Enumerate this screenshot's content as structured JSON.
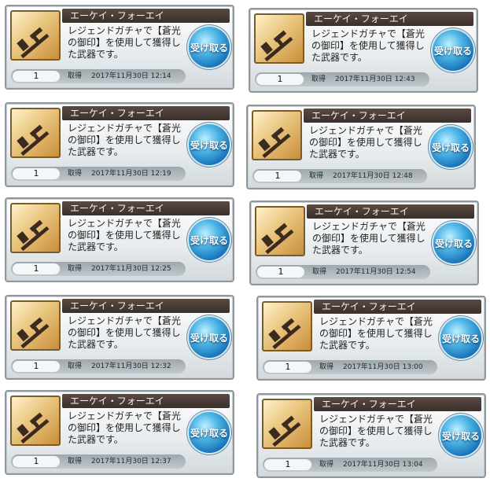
{
  "cards": [
    {
      "item_name": "エーケイ・フォーエイ",
      "desc_l1": "レジェンドガチャで【蒼光",
      "desc_l2": "の御印】を使用して獲得し",
      "desc_l3": "た武器です。",
      "receive_label": "受け取る",
      "quantity": "1",
      "acquired_label": "取得",
      "acquired_at": "2017年11月30日 12:14",
      "icon": "assault-rifle-icon"
    },
    {
      "item_name": "エーケイ・フォーエイ",
      "desc_l1": "レジェンドガチャで【蒼光",
      "desc_l2": "の御印】を使用して獲得し",
      "desc_l3": "た武器です。",
      "receive_label": "受け取る",
      "quantity": "1",
      "acquired_label": "取得",
      "acquired_at": "2017年11月30日 12:43",
      "icon": "assault-rifle-icon"
    },
    {
      "item_name": "エーケイ・フォーエイ",
      "desc_l1": "レジェンドガチャで【蒼光",
      "desc_l2": "の御印】を使用して獲得し",
      "desc_l3": "た武器です。",
      "receive_label": "受け取る",
      "quantity": "1",
      "acquired_label": "取得",
      "acquired_at": "2017年11月30日 12:19",
      "icon": "assault-rifle-icon"
    },
    {
      "item_name": "エーケイ・フォーエイ",
      "desc_l1": "レジェンドガチャで【蒼光",
      "desc_l2": "の御印】を使用して獲得し",
      "desc_l3": "た武器です。",
      "receive_label": "受け取る",
      "quantity": "1",
      "acquired_label": "取得",
      "acquired_at": "2017年11月30日 12:48",
      "icon": "assault-rifle-icon"
    },
    {
      "item_name": "エーケイ・フォーエイ",
      "desc_l1": "レジェンドガチャで【蒼光",
      "desc_l2": "の御印】を使用して獲得し",
      "desc_l3": "た武器です。",
      "receive_label": "受け取る",
      "quantity": "1",
      "acquired_label": "取得",
      "acquired_at": "2017年11月30日 12:25",
      "icon": "assault-rifle-icon"
    },
    {
      "item_name": "エーケイ・フォーエイ",
      "desc_l1": "レジェンドガチャで【蒼光",
      "desc_l2": "の御印】を使用して獲得し",
      "desc_l3": "た武器です。",
      "receive_label": "受け取る",
      "quantity": "1",
      "acquired_label": "取得",
      "acquired_at": "2017年11月30日 12:54",
      "icon": "assault-rifle-icon"
    },
    {
      "item_name": "エーケイ・フォーエイ",
      "desc_l1": "レジェンドガチャで【蒼光",
      "desc_l2": "の御印】を使用して獲得し",
      "desc_l3": "た武器です。",
      "receive_label": "受け取る",
      "quantity": "1",
      "acquired_label": "取得",
      "acquired_at": "2017年11月30日 12:32",
      "icon": "assault-rifle-icon"
    },
    {
      "item_name": "エーケイ・フォーエイ",
      "desc_l1": "レジェンドガチャで【蒼光",
      "desc_l2": "の御印】を使用して獲得し",
      "desc_l3": "た武器です。",
      "receive_label": "受け取る",
      "quantity": "1",
      "acquired_label": "取得",
      "acquired_at": "2017年11月30日 13:00",
      "icon": "assault-rifle-icon"
    },
    {
      "item_name": "エーケイ・フォーエイ",
      "desc_l1": "レジェンドガチャで【蒼光",
      "desc_l2": "の御印】を使用して獲得し",
      "desc_l3": "た武器です。",
      "receive_label": "受け取る",
      "quantity": "1",
      "acquired_label": "取得",
      "acquired_at": "2017年11月30日 12:37",
      "icon": "assault-rifle-icon"
    },
    {
      "item_name": "エーケイ・フォーエイ",
      "desc_l1": "レジェンドガチャで【蒼光",
      "desc_l2": "の御印】を使用して獲得し",
      "desc_l3": "た武器です。",
      "receive_label": "受け取る",
      "quantity": "1",
      "acquired_label": "取得",
      "acquired_at": "2017年11月30日 13:04",
      "icon": "assault-rifle-icon"
    }
  ]
}
